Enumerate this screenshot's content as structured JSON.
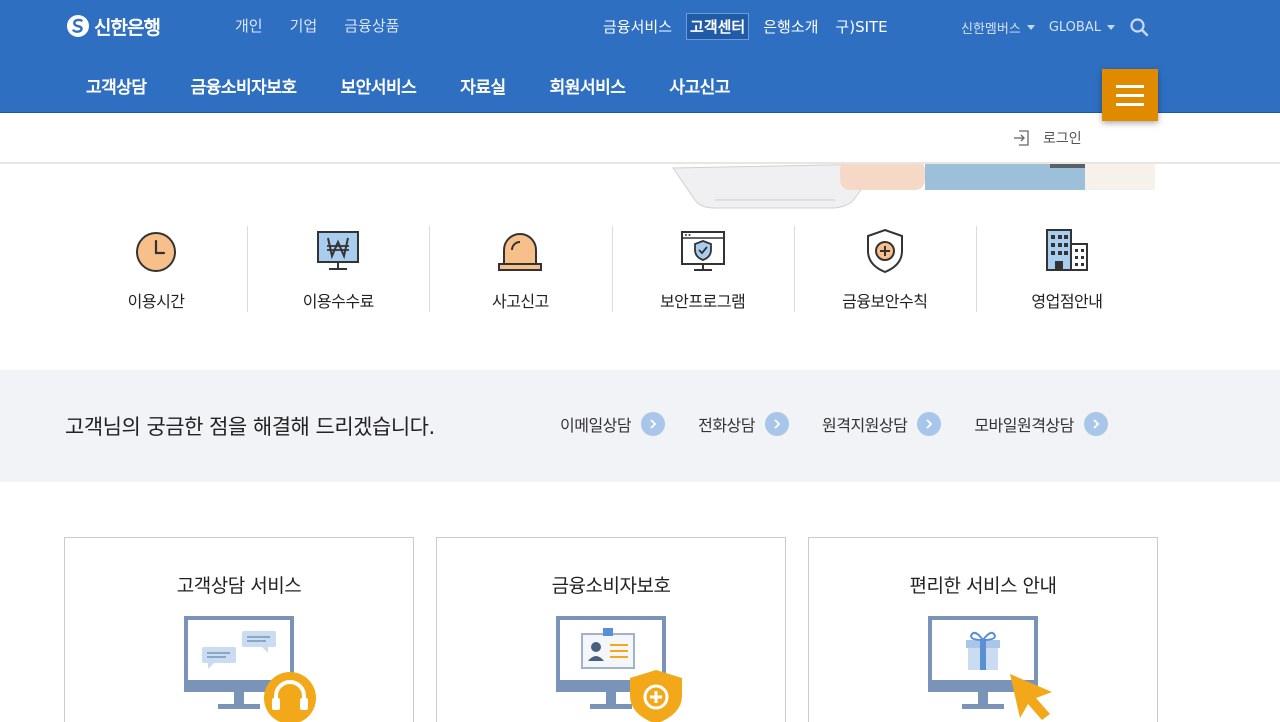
{
  "header": {
    "logo_text": "신한은행",
    "top_left_nav": [
      "개인",
      "기업",
      "금융상품"
    ],
    "top_center_nav": [
      {
        "label": "금융서비스",
        "active": false
      },
      {
        "label": "고객센터",
        "active": true
      },
      {
        "label": "은행소개",
        "active": false
      },
      {
        "label": "구)SITE",
        "active": false
      }
    ],
    "members_label": "신한멤버스",
    "global_label": "GLOBAL",
    "main_nav": [
      "고객상담",
      "금융소비자보호",
      "보안서비스",
      "자료실",
      "회원서비스",
      "사고신고"
    ]
  },
  "subbar": {
    "login_label": "로그인"
  },
  "quick_links": [
    {
      "label": "이용시간",
      "icon": "clock-icon"
    },
    {
      "label": "이용수수료",
      "icon": "won-monitor-icon"
    },
    {
      "label": "사고신고",
      "icon": "alarm-bell-icon"
    },
    {
      "label": "보안프로그램",
      "icon": "security-monitor-icon"
    },
    {
      "label": "금융보안수칙",
      "icon": "shield-plus-icon"
    },
    {
      "label": "영업점안내",
      "icon": "building-icon"
    }
  ],
  "consult": {
    "text": "고객님의 궁금한 점을 해결해 드리겠습니다.",
    "links": [
      "이메일상담",
      "전화상담",
      "원격지원상담",
      "모바일원격상담"
    ]
  },
  "cards": [
    {
      "title": "고객상담 서비스",
      "icon": "headset-monitor-icon"
    },
    {
      "title": "금융소비자보호",
      "icon": "id-card-shield-monitor-icon"
    },
    {
      "title": "편리한 서비스 안내",
      "icon": "gift-cursor-monitor-icon"
    }
  ],
  "colors": {
    "header_blue": "#2f6fc2",
    "menu_orange": "#e08a00",
    "icon_orange": "#f7c08a",
    "icon_blue": "#a9cdef",
    "consult_bg": "#f1f3f7"
  }
}
